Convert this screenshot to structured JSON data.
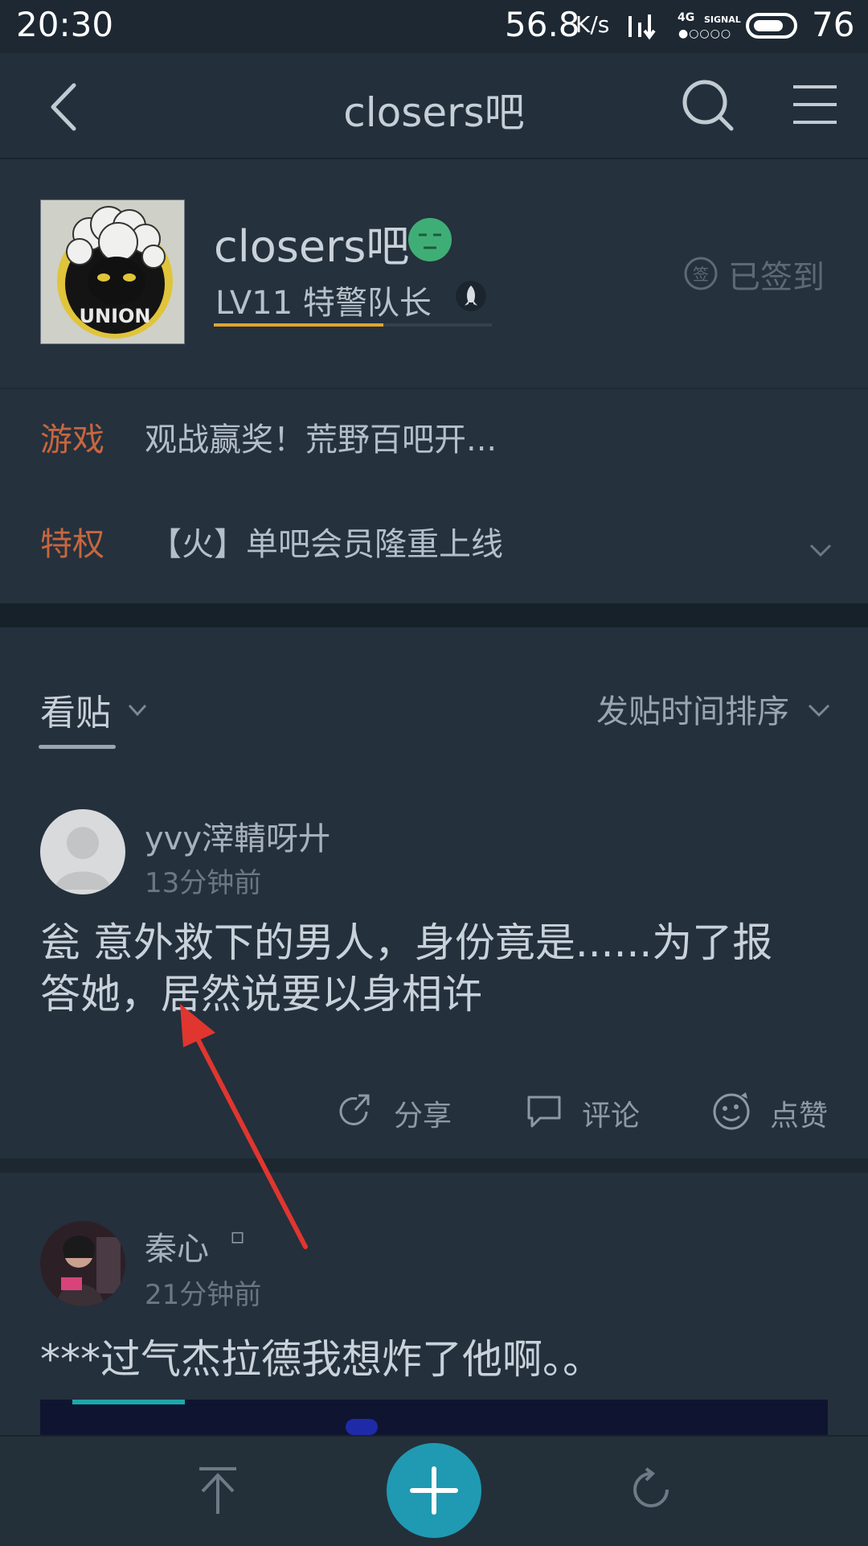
{
  "status_bar": {
    "time": "20:30",
    "speed": "56.8",
    "speed_unit": "K/s",
    "network": "4G",
    "signal_label": "SIGNAL",
    "signal_dots": "●○○○○",
    "battery": "76"
  },
  "nav": {
    "title": "closers吧"
  },
  "forum": {
    "name": "closers吧",
    "level": "LV11 特警队长",
    "level_progress": 0.61,
    "signin": "已签到",
    "signin_icon_char": "签"
  },
  "notices": [
    {
      "tag": "游戏",
      "text": "观战赢奖！荒野百吧开..."
    },
    {
      "tag": "特权",
      "text": "【火】单吧会员隆重上线"
    }
  ],
  "feed": {
    "tab": "看贴",
    "sort": "发贴时间排序"
  },
  "posts": [
    {
      "author": "yvy滓輤呀廾",
      "time": "13分钟前",
      "title_line1": "瓮  意外救下的男人，身份竟是......为了报",
      "title_line2": "答她，居然说要以身相许",
      "actions": {
        "share": "分享",
        "comment": "评论",
        "like": "点赞"
      }
    },
    {
      "author": "秦心",
      "author_badge": "▫",
      "time": "21分钟前",
      "title_line1": "***过气杰拉德我想炸了他啊。。"
    }
  ],
  "colors": {
    "accent": "#1f9ab2",
    "tag": "#c7663f",
    "arrow": "#e0362f",
    "level_bar": "#e3a52d",
    "emoji": "#3fae76"
  }
}
